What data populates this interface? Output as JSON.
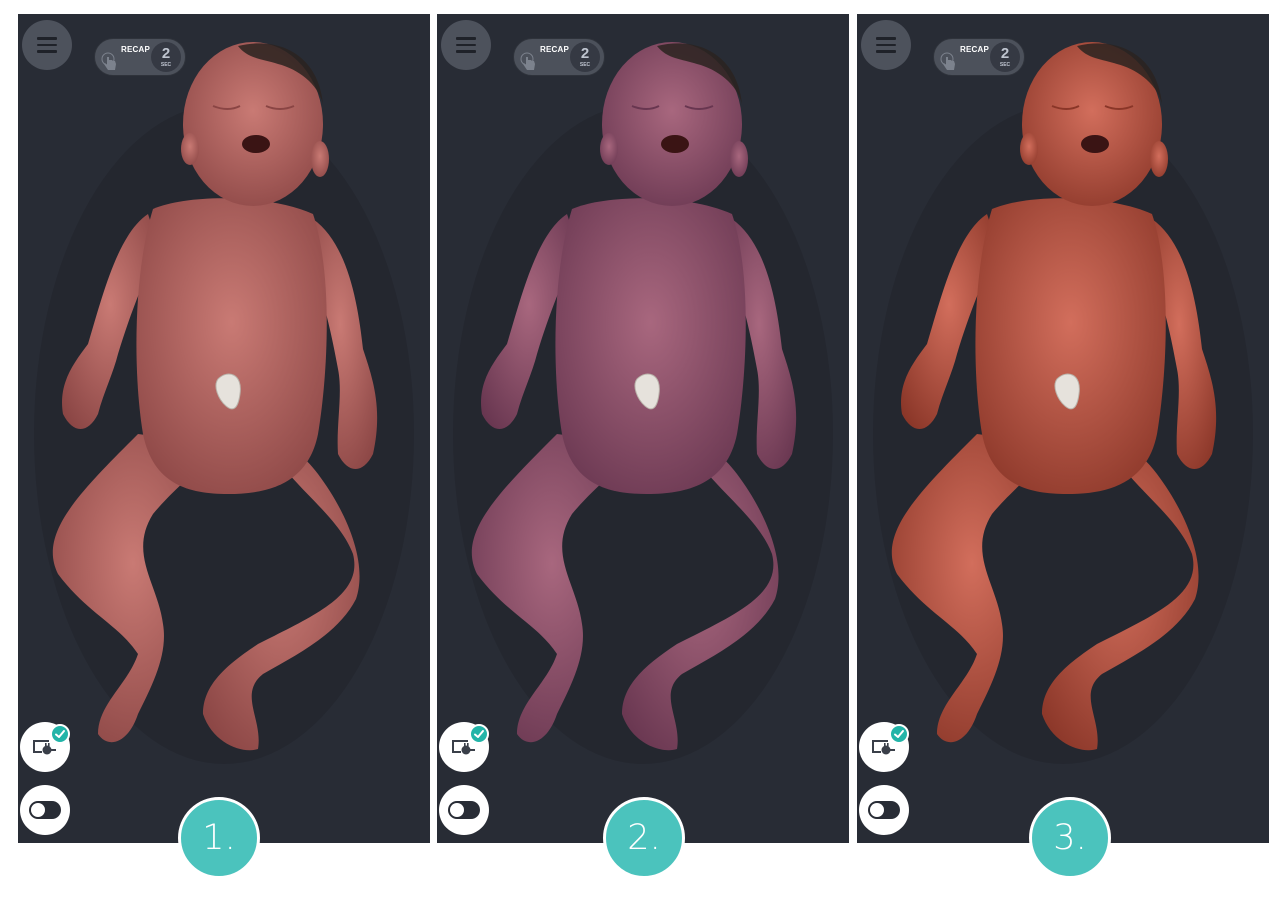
{
  "panels": [
    {
      "recap_label": "RECAP",
      "timer_value": "2",
      "timer_unit": "SEC",
      "step_label": "1.",
      "skin_color": "#c97a74",
      "skin_shade": "#8a4544"
    },
    {
      "recap_label": "RECAP",
      "timer_value": "2",
      "timer_unit": "SEC",
      "step_label": "2.",
      "skin_color": "#a8677e",
      "skin_shade": "#683650"
    },
    {
      "recap_label": "RECAP",
      "timer_value": "2",
      "timer_unit": "SEC",
      "step_label": "3.",
      "skin_color": "#d26e5c",
      "skin_shade": "#8a3628"
    }
  ],
  "icons": {
    "menu": "hamburger-menu-icon",
    "recap": "tap-hand-icon",
    "monitor": "monitor-connected-icon",
    "check": "check-icon",
    "toggle": "toggle-switch-icon"
  },
  "colors": {
    "panel_bg": "#282c35",
    "accent_teal": "#4bc3bd",
    "check_teal": "#22b4a8"
  }
}
